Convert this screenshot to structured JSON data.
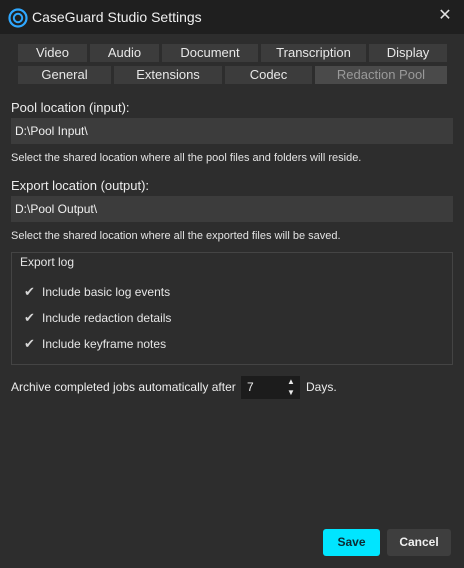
{
  "window": {
    "title": "CaseGuard Studio Settings",
    "close_glyph": "✕"
  },
  "tabs_row1": [
    "Video",
    "Audio",
    "Document",
    "Transcription",
    "Display"
  ],
  "tabs_row2": [
    "General",
    "Extensions",
    "Codec",
    "Redaction Pool"
  ],
  "active_tab": "Redaction Pool",
  "pool": {
    "label": "Pool location (input):",
    "value": "D:\\Pool Input\\",
    "help": "Select the shared location where all the pool files and folders will reside."
  },
  "export": {
    "label": "Export location (output):",
    "value": "D:\\Pool Output\\",
    "help": "Select the shared location where all the exported files will be saved."
  },
  "export_log": {
    "title": "Export log",
    "items": [
      {
        "label": "Include basic log events",
        "checked": true
      },
      {
        "label": "Include redaction details",
        "checked": true
      },
      {
        "label": "Include keyframe notes",
        "checked": true
      }
    ]
  },
  "archive": {
    "label": "Archive completed jobs automatically after",
    "days_value": "7",
    "suffix": "Days."
  },
  "buttons": {
    "save": "Save",
    "cancel": "Cancel"
  },
  "colors": {
    "accent": "#00e5ff",
    "background": "#2d2d2d",
    "titlebar": "#1f1f1f"
  },
  "icons": {
    "app": "caseguard-logo-icon",
    "close": "close-icon",
    "check": "checkmark-icon",
    "spin_up": "caret-up-icon",
    "spin_down": "caret-down-icon"
  }
}
